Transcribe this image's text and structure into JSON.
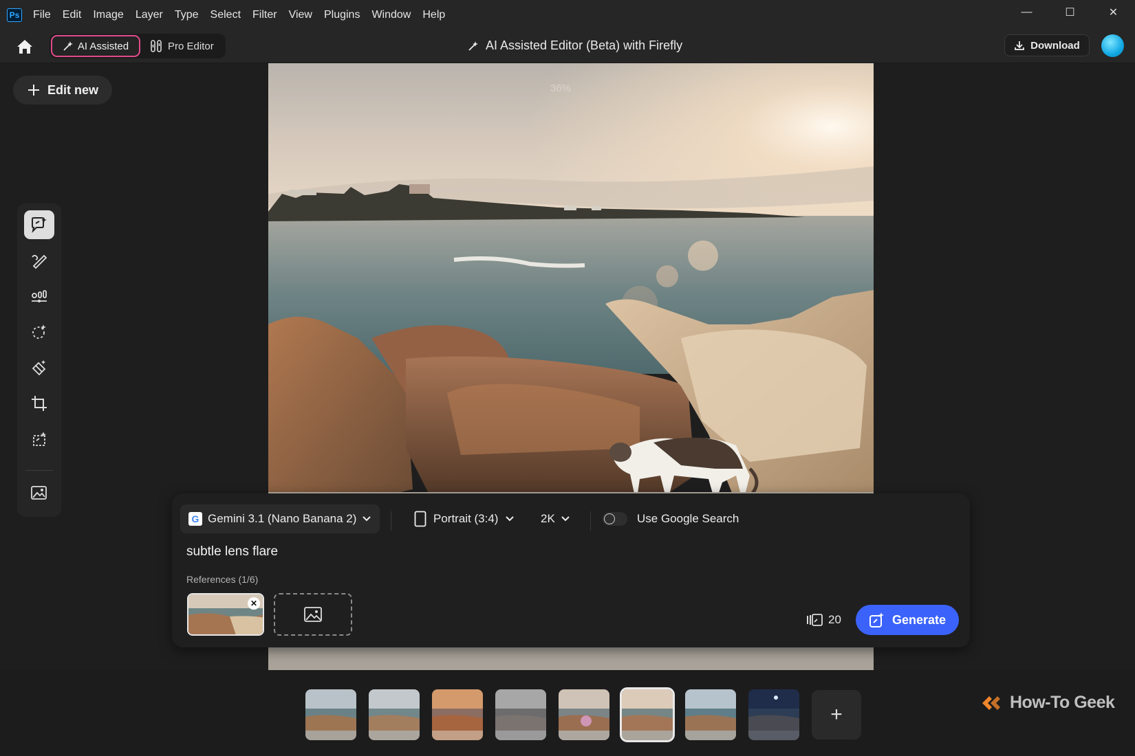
{
  "app": {
    "logo_text": "Ps"
  },
  "menu": [
    "File",
    "Edit",
    "Image",
    "Layer",
    "Type",
    "Select",
    "Filter",
    "View",
    "Plugins",
    "Window",
    "Help"
  ],
  "window_controls": {
    "minimize": "—",
    "maximize": "☐",
    "close": "✕"
  },
  "toolbar": {
    "ai_assisted_label": "AI Assisted",
    "pro_editor_label": "Pro Editor",
    "document_title": "AI Assisted Editor (Beta) with Firefly",
    "download_label": "Download"
  },
  "sidebar": {
    "edit_new_label": "Edit new",
    "tools": [
      {
        "icon": "prompt-edit-icon",
        "active": true
      },
      {
        "icon": "brush-edit-icon",
        "active": false
      },
      {
        "icon": "adjustments-icon",
        "active": false
      },
      {
        "icon": "magic-select-icon",
        "active": false
      },
      {
        "icon": "remove-object-icon",
        "active": false
      },
      {
        "icon": "crop-icon",
        "active": false
      },
      {
        "icon": "generative-expand-icon",
        "active": false
      },
      {
        "icon": "image-settings-icon",
        "active": false
      }
    ]
  },
  "canvas": {
    "zoom_text": "36%"
  },
  "prompt_panel": {
    "model_label": "Gemini 3.1 (Nano Banana 2)",
    "model_logo": "G",
    "aspect_label": "Portrait (3:4)",
    "resolution_label": "2K",
    "google_search_label": "Use Google Search",
    "google_search_enabled": false,
    "prompt_text": "subtle lens flare",
    "references_label": "References (1/6)",
    "credits_count": "20",
    "generate_label": "Generate"
  },
  "filmstrip": {
    "selected_index": 5,
    "add_label": "+"
  },
  "watermark": {
    "text": "How-To Geek"
  },
  "colors": {
    "accent_blue": "#3b63fb",
    "ai_border": "#e04b8a",
    "bg": "#1e1e1e"
  }
}
